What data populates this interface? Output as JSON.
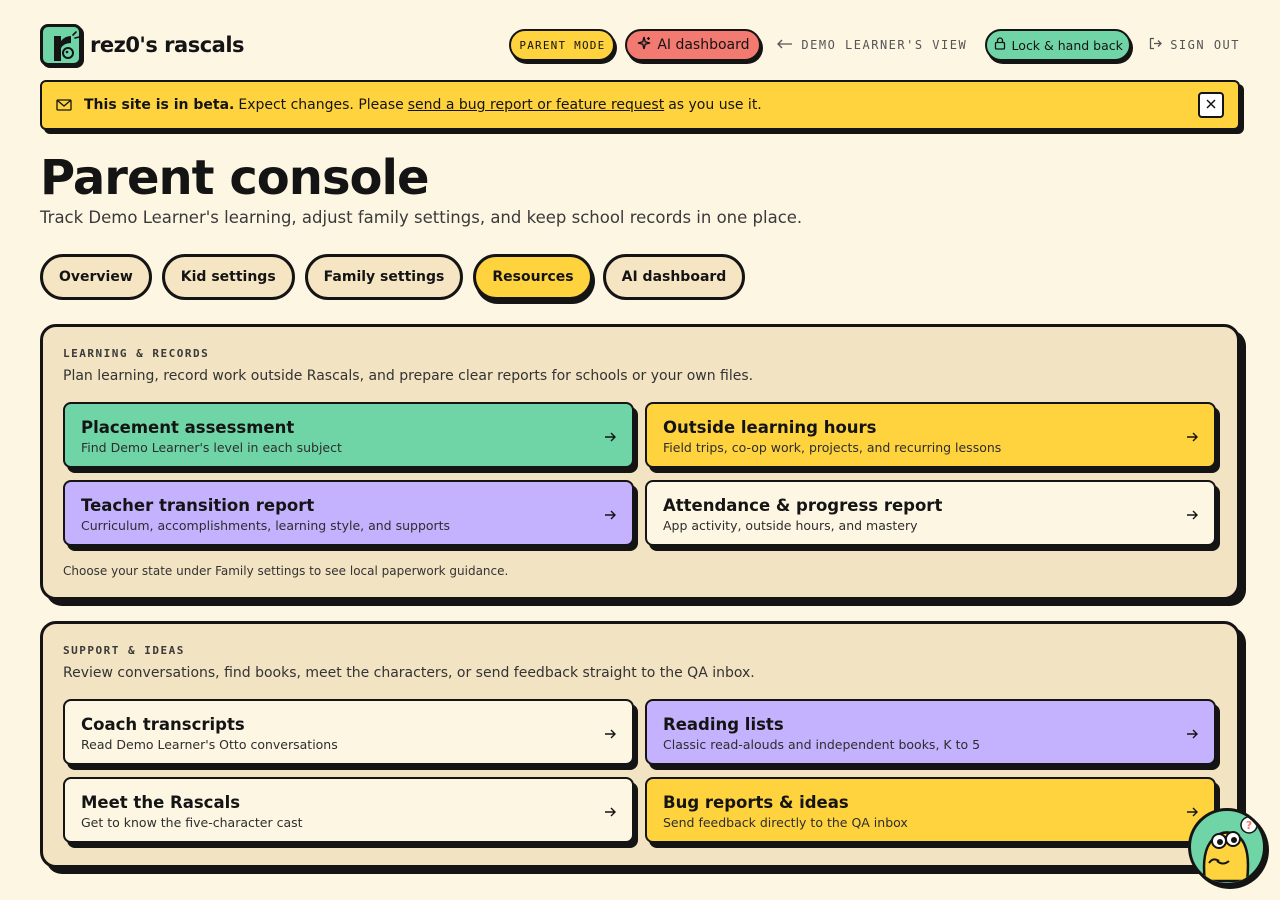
{
  "brand": {
    "name": "rez0's rascals",
    "logo_letter": "r"
  },
  "header": {
    "parent_mode": "PARENT MODE",
    "ai_dashboard": "AI dashboard",
    "learner_view": "DEMO LEARNER'S VIEW",
    "lock": "Lock & hand back",
    "sign_out": "SIGN OUT"
  },
  "banner": {
    "bold": "This site is in beta.",
    "text_before": "Expect changes. Please",
    "link": "send a bug report or feature request",
    "text_after": "as you use it."
  },
  "page": {
    "title": "Parent console",
    "subtitle": "Track Demo Learner's learning, adjust family settings, and keep school records in one place."
  },
  "tabs": [
    {
      "label": "Overview",
      "active": false
    },
    {
      "label": "Kid settings",
      "active": false
    },
    {
      "label": "Family settings",
      "active": false
    },
    {
      "label": "Resources",
      "active": true
    },
    {
      "label": "AI dashboard",
      "active": false
    }
  ],
  "sections": [
    {
      "eyebrow": "LEARNING & RECORDS",
      "desc": "Plan learning, record work outside Rascals, and prepare clear reports for schools or your own files.",
      "cards": [
        {
          "title": "Placement assessment",
          "sub": "Find Demo Learner's level in each subject",
          "color": "#6fd5a6"
        },
        {
          "title": "Outside learning hours",
          "sub": "Field trips, co-op work, projects, and recurring lessons",
          "color": "#ffd33d"
        },
        {
          "title": "Teacher transition report",
          "sub": "Curriculum, accomplishments, learning style, and supports",
          "color": "#c4b2ff"
        },
        {
          "title": "Attendance & progress report",
          "sub": "App activity, outside hours, and mastery",
          "color": "#fdf6e3"
        }
      ],
      "note": "Choose your state under Family settings to see local paperwork guidance."
    },
    {
      "eyebrow": "SUPPORT & IDEAS",
      "desc": "Review conversations, find books, meet the characters, or send feedback straight to the QA inbox.",
      "cards": [
        {
          "title": "Coach transcripts",
          "sub": "Read Demo Learner's Otto conversations",
          "color": "#fdf6e3"
        },
        {
          "title": "Reading lists",
          "sub": "Classic read-alouds and independent books, K to 5",
          "color": "#c4b2ff"
        },
        {
          "title": "Meet the Rascals",
          "sub": "Get to know the five-character cast",
          "color": "#fdf6e3"
        },
        {
          "title": "Bug reports & ideas",
          "sub": "Send feedback directly to the QA inbox",
          "color": "#ffd33d"
        }
      ]
    }
  ],
  "colors": {
    "accent_yellow": "#ffd33d",
    "accent_green": "#6fd5a6",
    "accent_purple": "#c4b2ff",
    "accent_red": "#f27a70",
    "background": "#fdf6e3"
  },
  "icons": [
    "mail-icon",
    "close-icon",
    "sparkle-icon",
    "lock-icon",
    "sign-out-icon",
    "arrow-right-icon",
    "mascot-icon"
  ]
}
